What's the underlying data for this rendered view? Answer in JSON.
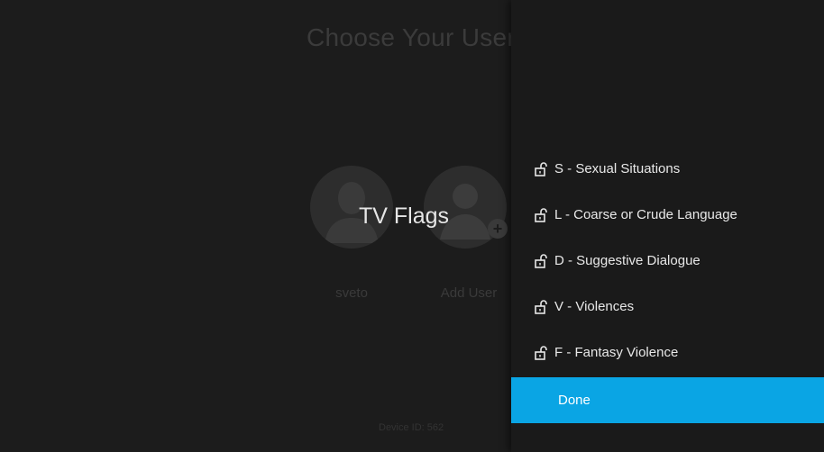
{
  "background": {
    "title": "Choose Your User",
    "users": [
      {
        "label": "sveto",
        "icon": "person-avatar-icon"
      },
      {
        "label": "Add User",
        "icon": "add-user-avatar-icon"
      }
    ],
    "device_id": "Device ID: 562"
  },
  "dialog": {
    "title": "TV Flags"
  },
  "flags_menu": {
    "items": [
      {
        "label": "S - Sexual Situations",
        "icon": "unlocked-lock-icon"
      },
      {
        "label": "L - Coarse or Crude Language",
        "icon": "unlocked-lock-icon"
      },
      {
        "label": "D - Suggestive Dialogue",
        "icon": "unlocked-lock-icon"
      },
      {
        "label": "V - Violences",
        "icon": "unlocked-lock-icon"
      },
      {
        "label": "F - Fantasy Violence",
        "icon": "unlocked-lock-icon"
      }
    ],
    "done_label": "Done"
  },
  "colors": {
    "accent": "#0aa5e4",
    "panel_bg": "#1a1a1a",
    "screen_bg": "#1c1c1c"
  }
}
